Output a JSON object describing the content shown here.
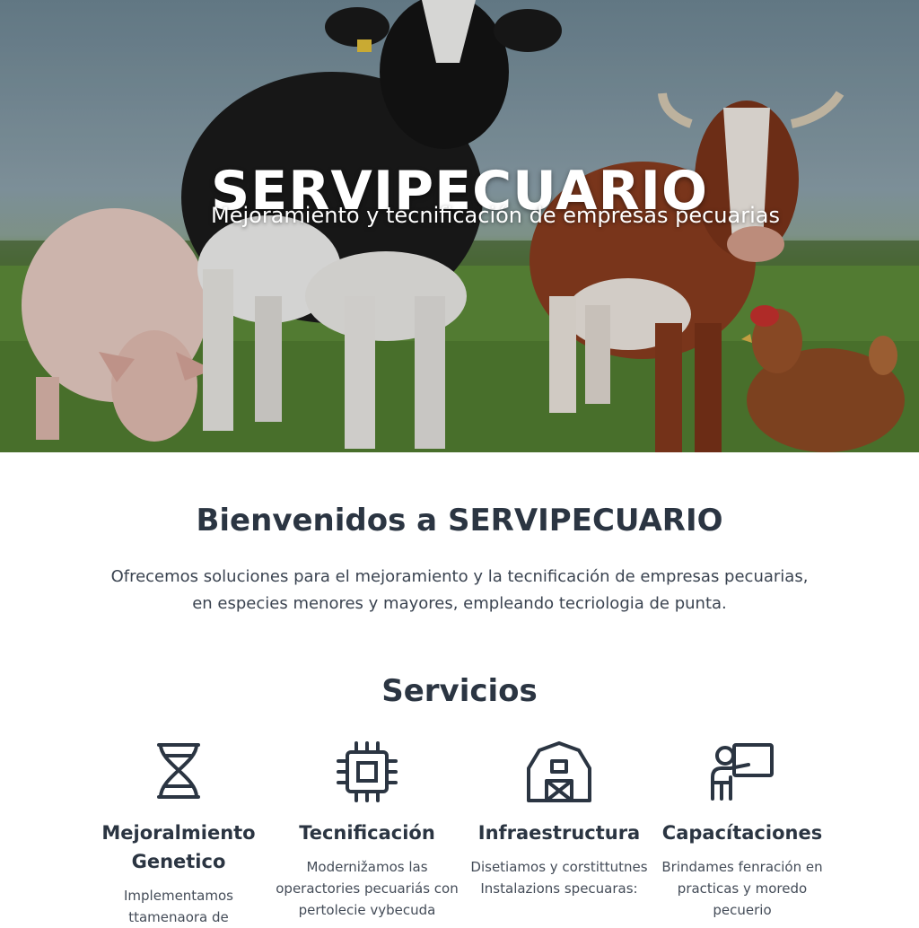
{
  "hero": {
    "title": "SERVIPECUARIO",
    "subtitle": "Mejoramiento y tecnificación de empresas pecuarias"
  },
  "intro": {
    "heading": "Bienvenidos a SERVIPECUARIO",
    "text": "Ofrecemos soluciones para el mejoramiento y la tecnificación de empresas pecuarias, en especies menores y mayores, empleando tecriologia de punta."
  },
  "services": {
    "heading": "Servicios",
    "items": [
      {
        "icon": "dna-icon",
        "name": "Mejoralmiento Genetico",
        "desc": "Implementamos ttamenaora de"
      },
      {
        "icon": "chip-icon",
        "name": "Tecnificación",
        "desc": "Modernižamos las operactories pecuariás con pertolecie vybecuda"
      },
      {
        "icon": "barn-icon",
        "name": "Infraestructura",
        "desc": "Disetiamos y corstittutnes Instalazions specuaras:"
      },
      {
        "icon": "teacher-board-icon",
        "name": "Capacítaciones",
        "desc": "Brindames fenración en practicas y moredo pecuerio"
      }
    ]
  },
  "colors": {
    "heading": "#2b3542",
    "body_text": "#3a4350",
    "icon": "#2b3542"
  }
}
